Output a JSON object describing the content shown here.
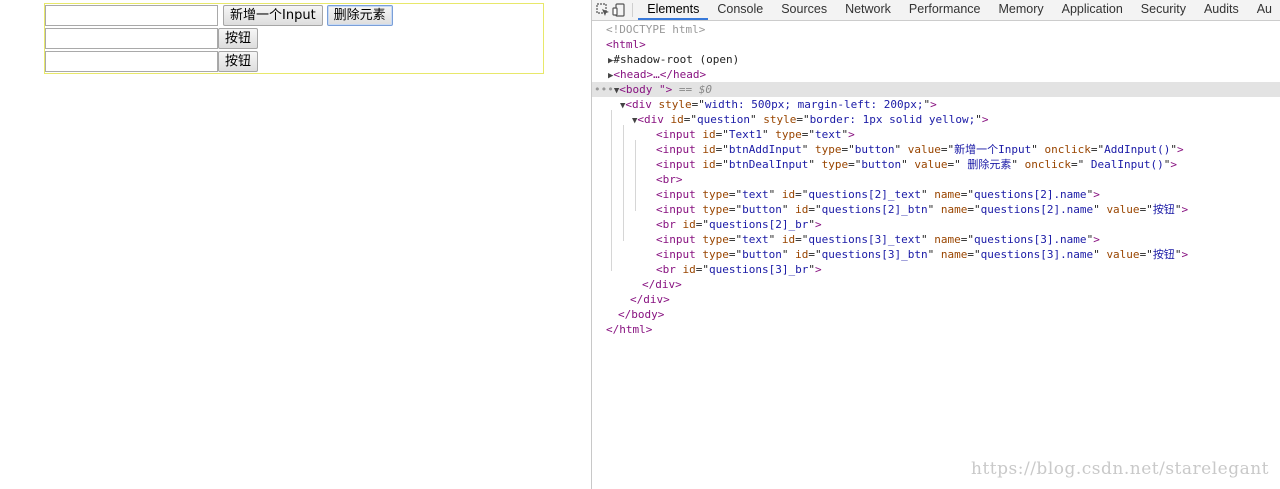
{
  "page": {
    "row1": {
      "text_value": "",
      "add_button": "新增一个Input",
      "delete_button": "删除元素"
    },
    "row2": {
      "text_value": "",
      "button": "按钮"
    },
    "row3": {
      "text_value": "",
      "button": "按钮"
    }
  },
  "devtools": {
    "tabs": [
      "Elements",
      "Console",
      "Sources",
      "Network",
      "Performance",
      "Memory",
      "Application",
      "Security",
      "Audits",
      "Au"
    ],
    "active_tab": "Elements",
    "icons": [
      "inspect-element-icon",
      "device-toolbar-icon"
    ],
    "tree": {
      "doctype": "<!DOCTYPE html>",
      "html_open": "<html>",
      "shadow_root": "#shadow-root (open)",
      "head": "<head>…</head>",
      "body_open": "<body \">",
      "body_suffix": " == $0",
      "div_outer": {
        "tag": "<div",
        "attr": "style",
        "value": "width: 500px; margin-left: 200px;"
      },
      "div_question": {
        "tag": "<div",
        "attrs": [
          [
            "id",
            "question"
          ],
          [
            "style",
            "border: 1px solid yellow;"
          ]
        ]
      },
      "lines": [
        [
          [
            "id",
            "Text1"
          ],
          [
            "type",
            "text"
          ]
        ],
        [
          [
            "id",
            "btnAddInput"
          ],
          [
            "type",
            "button"
          ],
          [
            "value",
            "新增一个Input"
          ],
          [
            "onclick",
            "AddInput()"
          ]
        ],
        [
          [
            "id",
            "btnDealInput"
          ],
          [
            "type",
            "button"
          ],
          [
            "value",
            " 删除元素"
          ],
          [
            "onclick",
            " DealInput()"
          ]
        ],
        [],
        [
          [
            "type",
            "text"
          ],
          [
            "id",
            "questions[2]_text"
          ],
          [
            "name",
            "questions[2].name"
          ]
        ],
        [
          [
            "type",
            "button"
          ],
          [
            "id",
            "questions[2]_btn"
          ],
          [
            "name",
            "questions[2].name"
          ],
          [
            "value",
            "按钮"
          ]
        ],
        [
          [
            "id",
            "questions[2]_br"
          ]
        ],
        [
          [
            "type",
            "text"
          ],
          [
            "id",
            "questions[3]_text"
          ],
          [
            "name",
            "questions[3].name"
          ]
        ],
        [
          [
            "type",
            "button"
          ],
          [
            "id",
            "questions[3]_btn"
          ],
          [
            "name",
            "questions[3].name"
          ],
          [
            "value",
            "按钮"
          ]
        ],
        [
          [
            "id",
            "questions[3]_br"
          ]
        ]
      ],
      "div_close": "</div>",
      "body_close": "</body>",
      "html_close": "</html>"
    }
  },
  "watermark": "https://blog.csdn.net/starelegant",
  "colors": {
    "tag": "#881280",
    "attr_name": "#994500",
    "attr_value": "#1a1aa6",
    "tab_accent": "#3879d9",
    "question_border": "#e8e86a"
  }
}
